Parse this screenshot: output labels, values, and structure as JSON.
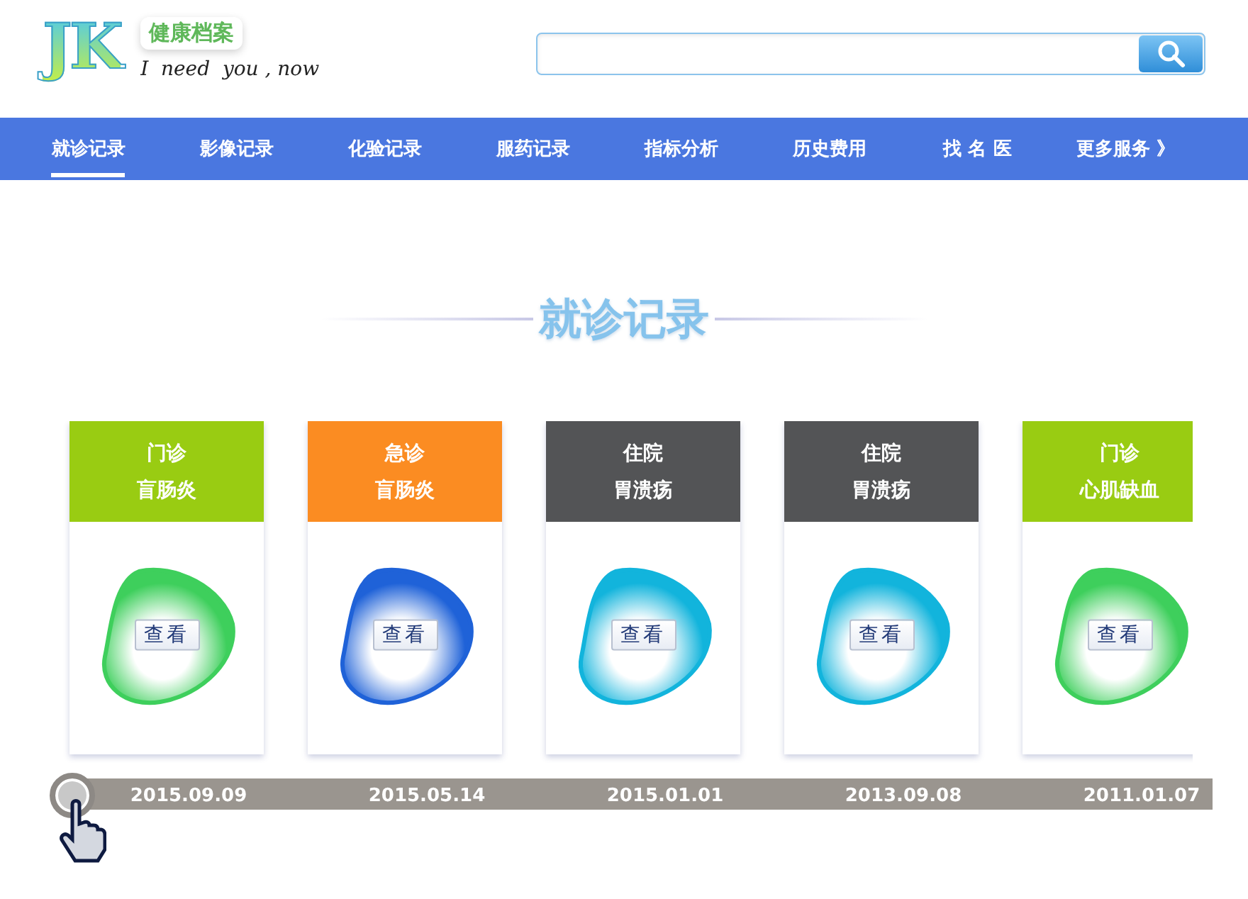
{
  "header": {
    "logo": "JK",
    "brand": "健康档案",
    "slogan": "I  need  you , now"
  },
  "nav": [
    {
      "label": "就诊记录",
      "selected": true
    },
    {
      "label": "影像记录",
      "selected": false
    },
    {
      "label": "化验记录",
      "selected": false
    },
    {
      "label": "服药记录",
      "selected": false
    },
    {
      "label": "指标分析",
      "selected": false
    },
    {
      "label": "历史费用",
      "selected": false
    },
    {
      "label": "找 名 医",
      "selected": false
    },
    {
      "label": "更多服务 》",
      "selected": false
    }
  ],
  "section_title": "就诊记录",
  "records": [
    {
      "type": "门诊",
      "diagnosis": "盲肠炎",
      "color": "#99cc12",
      "blob": {
        "color": "#3ecf5c"
      },
      "button": "查看",
      "date": "2015.09.09"
    },
    {
      "type": "急诊",
      "diagnosis": "盲肠炎",
      "color": "#fb8c22",
      "blob": {
        "color": "#1f62d8"
      },
      "button": "查看",
      "date": "2015.05.14"
    },
    {
      "type": "住院",
      "diagnosis": "胃溃疡",
      "color": "#535456",
      "blob": {
        "color": "#12b4dc"
      },
      "button": "查看",
      "date": "2015.01.01"
    },
    {
      "type": "住院",
      "diagnosis": "胃溃疡",
      "color": "#535456",
      "blob": {
        "color": "#12b4dc"
      },
      "button": "查看",
      "date": "2013.09.08"
    },
    {
      "type": "门诊",
      "diagnosis": "心肌缺血",
      "color": "#99cc12",
      "blob": {
        "color": "#3ecf5c"
      },
      "button": "查看",
      "date": "2011.01.07"
    }
  ]
}
